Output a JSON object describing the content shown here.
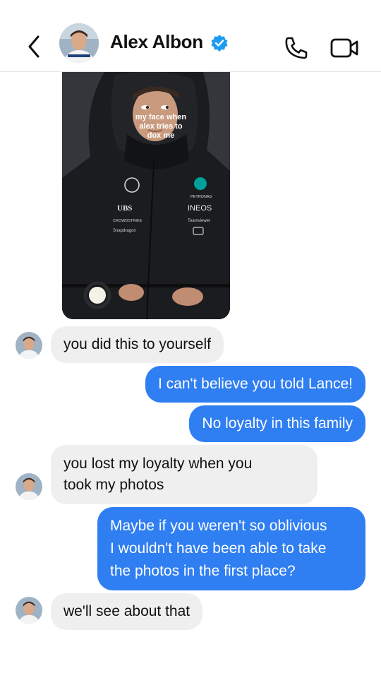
{
  "header": {
    "contact_name": "Alex Albon",
    "verified": true,
    "icons": [
      "back-chevron-icon",
      "verified-badge-icon",
      "phone-icon",
      "video-camera-icon"
    ],
    "accent_color": "#2f7ef2"
  },
  "meme": {
    "caption": "my face when\nalex tries to\ndox me"
  },
  "messages": [
    {
      "from": "contact",
      "text": "you did this to yourself"
    },
    {
      "from": "me",
      "text": "I can't believe you told Lance!"
    },
    {
      "from": "me",
      "text": "No loyalty in this family"
    },
    {
      "from": "contact",
      "text": "you lost my loyalty when you\ntook my photos"
    },
    {
      "from": "me",
      "text": "Maybe if you weren't so oblivious\nI wouldn't have been able to take\nthe photos in the first place?"
    },
    {
      "from": "contact",
      "text": "we'll see about that"
    }
  ],
  "colors": {
    "incoming_bubble": "#efefef",
    "outgoing_bubble": "#2f7ef2",
    "verified_badge": "#1d9bf0"
  }
}
